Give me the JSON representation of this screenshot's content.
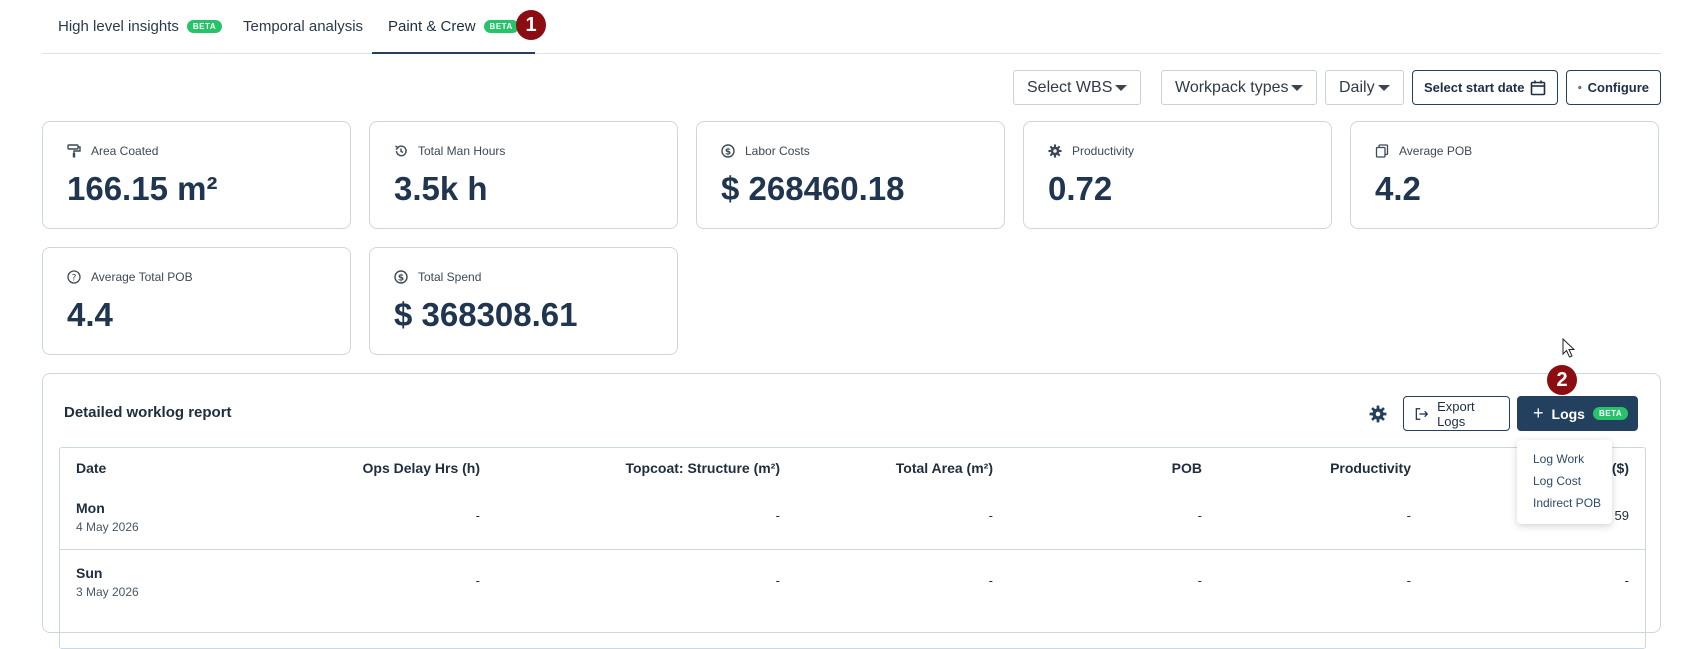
{
  "tabs": [
    {
      "label": "High level insights",
      "badge": "BETA"
    },
    {
      "label": "Temporal analysis",
      "badge": ""
    },
    {
      "label": "Paint & Crew",
      "badge": "BETA"
    }
  ],
  "markers": [
    "1",
    "2"
  ],
  "toolbar": {
    "wbs": "Select WBS",
    "workpack": "Workpack types",
    "period": "Daily",
    "start_date": "Select start date",
    "configure": "Configure"
  },
  "cards": [
    {
      "label": "Area Coated",
      "value": "166.15 m²",
      "icon": "paint-roller-icon"
    },
    {
      "label": "Total Man Hours",
      "value": "3.5k h",
      "icon": "history-icon"
    },
    {
      "label": "Labor Costs",
      "value": "$ 268460.18",
      "icon": "dollar-icon"
    },
    {
      "label": "Productivity",
      "value": "0.72",
      "icon": "gear-icon"
    },
    {
      "label": "Average POB",
      "value": "4.2",
      "icon": "copy-icon"
    },
    {
      "label": "Average Total POB",
      "value": "4.4",
      "icon": "question-icon"
    },
    {
      "label": "Total Spend",
      "value": "$ 368308.61",
      "icon": "dollar-icon"
    }
  ],
  "report": {
    "title": "Detailed worklog report",
    "export": "Export Logs",
    "logs_button": "Logs",
    "logs_badge": "BETA",
    "menu": [
      "Log Work",
      "Log Cost",
      "Indirect POB"
    ],
    "columns": [
      "Date",
      "Ops Delay Hrs (h)",
      "Topcoat: Structure (m²)",
      "Total Area (m²)",
      "POB",
      "Productivity",
      "($)"
    ],
    "rows": [
      {
        "day": "Mon",
        "date": "4 May 2026",
        "cells": [
          "-",
          "-",
          "-",
          "-",
          "-",
          "59"
        ]
      },
      {
        "day": "Sun",
        "date": "3 May 2026",
        "cells": [
          "-",
          "-",
          "-",
          "-",
          "-",
          "-"
        ]
      }
    ]
  },
  "colors": {
    "primary": "#23405f",
    "beta": "#27c36a",
    "marker": "#8b0d12"
  }
}
